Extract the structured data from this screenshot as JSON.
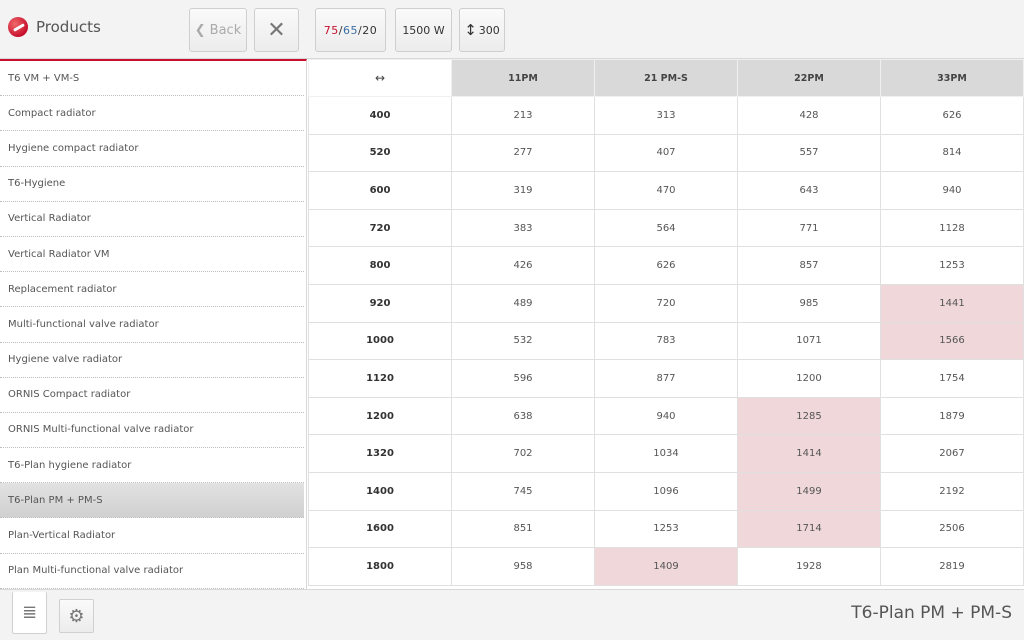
{
  "header": {
    "title": "Products",
    "back_label": "Back",
    "close_label": "✕",
    "temp": {
      "flow": "75",
      "return": "65",
      "room": "20"
    },
    "power_label": "1500 W",
    "height_label": "300"
  },
  "sidebar": {
    "items": [
      "T6 VM + VM-S",
      "Compact radiator",
      "Hygiene compact radiator",
      "T6-Hygiene",
      "Vertical Radiator",
      "Vertical Radiator VM",
      "Replacement radiator",
      "Multi-functional valve radiator",
      "Hygiene valve radiator",
      "ORNIS Compact radiator",
      "ORNIS Multi-functional valve radiator",
      "T6-Plan hygiene radiator",
      "T6-Plan PM + PM-S",
      "Plan-Vertical Radiator",
      "Plan Multi-functional valve radiator"
    ],
    "active_index": 12
  },
  "table": {
    "corner": "↔",
    "columns": [
      "11PM",
      "21 PM-S",
      "22PM",
      "33PM"
    ],
    "rows": [
      {
        "length": "400",
        "values": [
          "213",
          "313",
          "428",
          "626"
        ],
        "hl": [
          false,
          false,
          false,
          false
        ]
      },
      {
        "length": "520",
        "values": [
          "277",
          "407",
          "557",
          "814"
        ],
        "hl": [
          false,
          false,
          false,
          false
        ]
      },
      {
        "length": "600",
        "values": [
          "319",
          "470",
          "643",
          "940"
        ],
        "hl": [
          false,
          false,
          false,
          false
        ]
      },
      {
        "length": "720",
        "values": [
          "383",
          "564",
          "771",
          "1128"
        ],
        "hl": [
          false,
          false,
          false,
          false
        ]
      },
      {
        "length": "800",
        "values": [
          "426",
          "626",
          "857",
          "1253"
        ],
        "hl": [
          false,
          false,
          false,
          false
        ]
      },
      {
        "length": "920",
        "values": [
          "489",
          "720",
          "985",
          "1441"
        ],
        "hl": [
          false,
          false,
          false,
          true
        ]
      },
      {
        "length": "1000",
        "values": [
          "532",
          "783",
          "1071",
          "1566"
        ],
        "hl": [
          false,
          false,
          false,
          true
        ]
      },
      {
        "length": "1120",
        "values": [
          "596",
          "877",
          "1200",
          "1754"
        ],
        "hl": [
          false,
          false,
          false,
          false
        ]
      },
      {
        "length": "1200",
        "values": [
          "638",
          "940",
          "1285",
          "1879"
        ],
        "hl": [
          false,
          false,
          true,
          false
        ]
      },
      {
        "length": "1320",
        "values": [
          "702",
          "1034",
          "1414",
          "2067"
        ],
        "hl": [
          false,
          false,
          true,
          false
        ]
      },
      {
        "length": "1400",
        "values": [
          "745",
          "1096",
          "1499",
          "2192"
        ],
        "hl": [
          false,
          false,
          true,
          false
        ]
      },
      {
        "length": "1600",
        "values": [
          "851",
          "1253",
          "1714",
          "2506"
        ],
        "hl": [
          false,
          false,
          true,
          false
        ]
      },
      {
        "length": "1800",
        "values": [
          "958",
          "1409",
          "1928",
          "2819"
        ],
        "hl": [
          false,
          true,
          false,
          false
        ]
      }
    ]
  },
  "footer": {
    "title": "T6-Plan PM + PM-S"
  },
  "colors": {
    "accent": "#c8102e",
    "highlight": "#f0d8da",
    "return_temp": "#3a6ea5"
  }
}
